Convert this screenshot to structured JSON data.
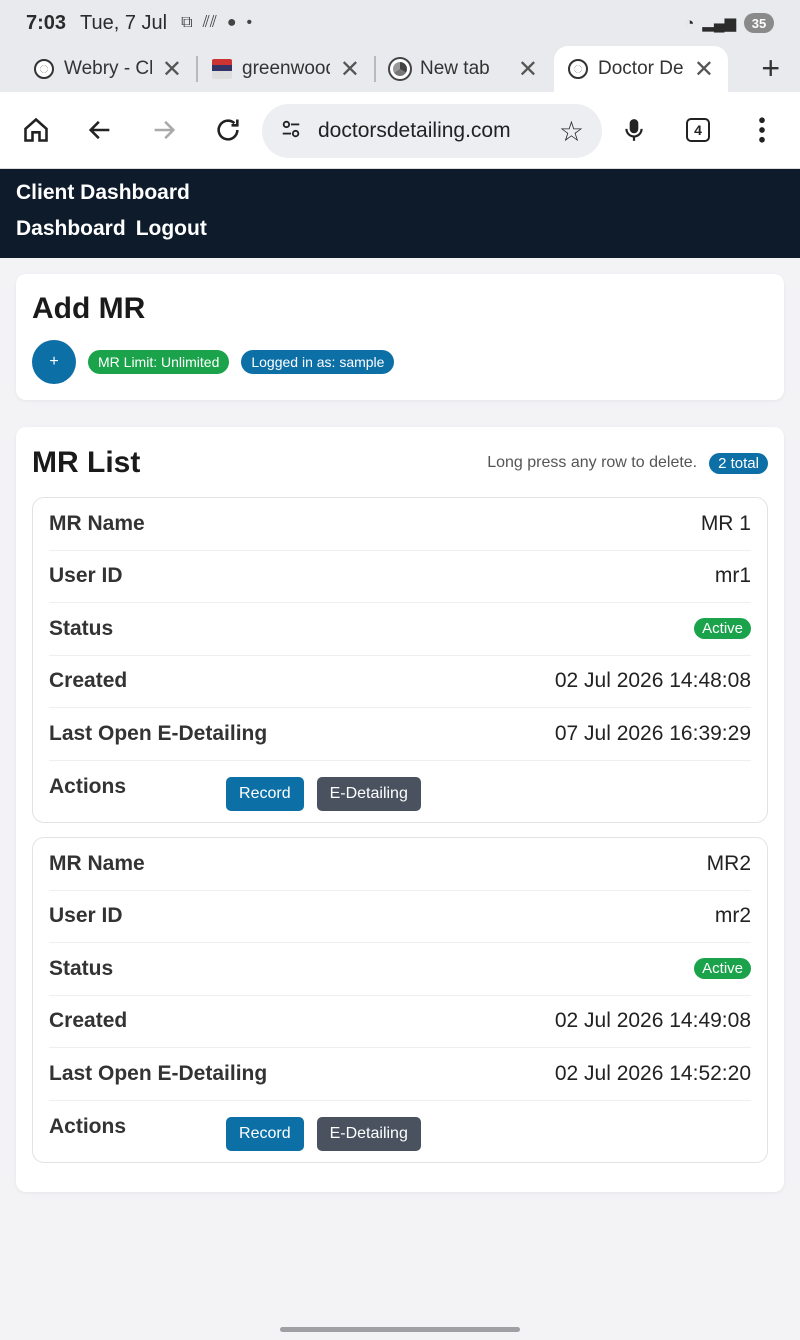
{
  "status_bar": {
    "time": "7:03",
    "date": "Tue, 7 Jul",
    "battery": "35"
  },
  "tabs": [
    {
      "title": "Webry - Cli",
      "favicon": "globe-icon"
    },
    {
      "title": "greenwood",
      "favicon": "doc-icon"
    },
    {
      "title": "New tab",
      "favicon": "chrome-icon"
    },
    {
      "title": "Doctor Det",
      "favicon": "globe-icon",
      "active": true
    }
  ],
  "toolbar": {
    "url": "doctorsdetailing.com",
    "tab_count": "4"
  },
  "app": {
    "title": "Client Dashboard",
    "nav": [
      "Dashboard",
      "Logout"
    ]
  },
  "add_mr": {
    "title": "Add MR",
    "fab_label": "+",
    "limit_badge": "MR Limit: Unlimited",
    "user_badge": "Logged in as: sample"
  },
  "mr_list": {
    "title": "MR List",
    "hint": "Long press any row to delete.",
    "total": "2 total",
    "labels": {
      "name": "MR Name",
      "user_id": "User ID",
      "status": "Status",
      "created": "Created",
      "last_open": "Last Open E-Detailing",
      "actions": "Actions"
    },
    "buttons": {
      "record": "Record",
      "edetailing": "E-Detailing"
    },
    "items": [
      {
        "name": "MR 1",
        "user_id": "mr1",
        "status": "Active",
        "created": "02 Jul 2026 14:48:08",
        "last_open": "07 Jul 2026 16:39:29"
      },
      {
        "name": "MR2",
        "user_id": "mr2",
        "status": "Active",
        "created": "02 Jul 2026 14:49:08",
        "last_open": "02 Jul 2026 14:52:20"
      }
    ]
  },
  "colors": {
    "header_bg": "#0e1b2b",
    "primary": "#0c6fa6",
    "success": "#1aa34a",
    "secondary": "#4a5260"
  }
}
